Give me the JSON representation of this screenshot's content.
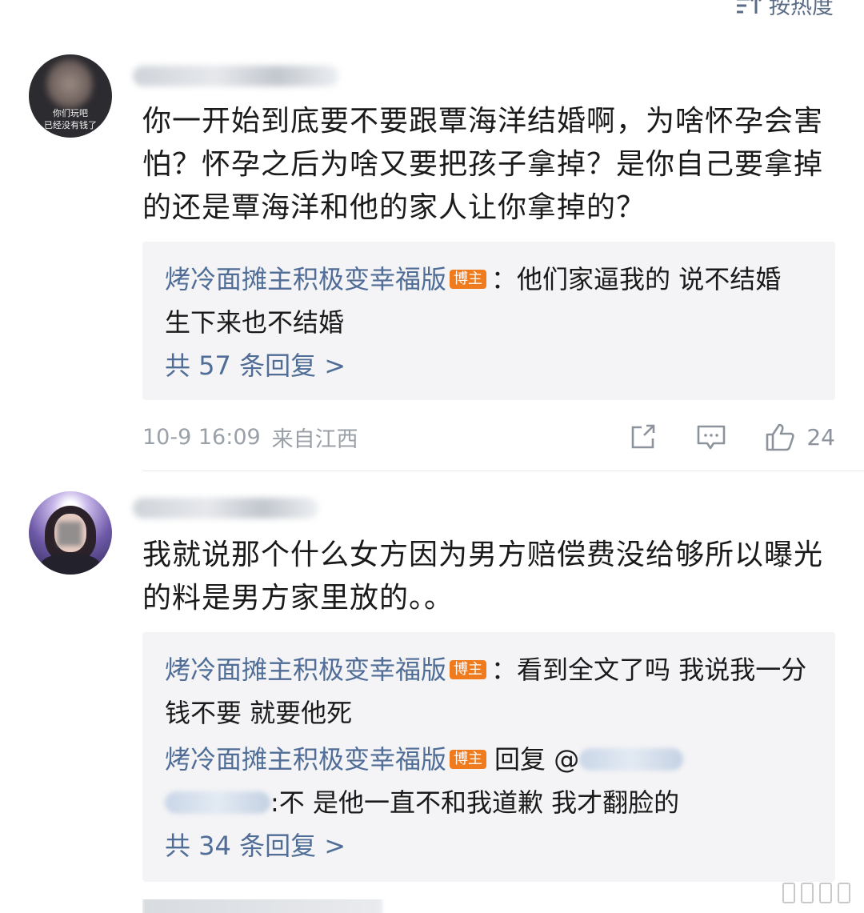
{
  "sort": {
    "label": "按热度",
    "icon": "sort-icon"
  },
  "comments": [
    {
      "avatar_caption": "你们玩吧\n已经没有钱了",
      "text": "你一开始到底要不要跟覃海洋结婚啊，为啥怀孕会害怕？怀孕之后为啥又要把孩子拿掉？是你自己要拿掉的还是覃海洋和他的家人让你拿掉的？",
      "replies": [
        {
          "author": "烤冷面摊主积极变幸福版",
          "badge": "博主",
          "text": "：他们家逼我的 说不结婚 生下来也不结婚"
        }
      ],
      "reply_count_link": "共 57 条回复 >",
      "time": "10-9 16:09",
      "location": "来自江西",
      "likes": "24"
    },
    {
      "text": "我就说那个什么女方因为男方赔偿费没给够所以曝光的料是男方家里放的。。",
      "replies": [
        {
          "author": "烤冷面摊主积极变幸福版",
          "badge": "博主",
          "text": "：看到全文了吗 我说我一分钱不要 就要他死"
        },
        {
          "author": "烤冷面摊主积极变幸福版",
          "badge": "博主",
          "reply_prefix": "回复 @",
          "text": ":不 是他一直不和我道歉 我才翻脸的"
        }
      ],
      "reply_count_link": "共 34 条回复 >"
    }
  ],
  "icons": {
    "share": "share-icon",
    "comment": "comment-icon",
    "like": "like-icon"
  },
  "colors": {
    "link": "#4f6d96",
    "badge": "#f07b1d",
    "meta": "#9aa0a8"
  }
}
